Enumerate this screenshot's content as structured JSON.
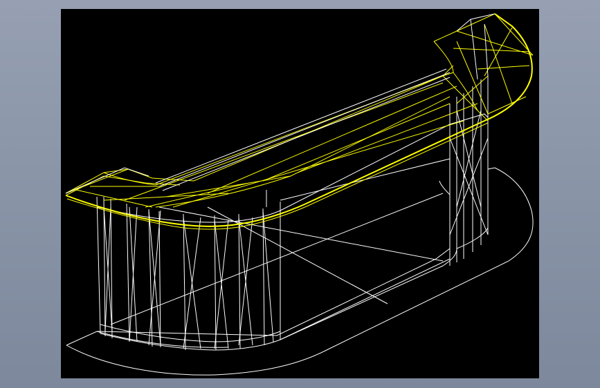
{
  "viewport": {
    "background": "#000000",
    "frame_background": "#8e99ac"
  },
  "colors": {
    "base_wire": "#ffffff",
    "countertop_wire": "#ffff00"
  },
  "model": {
    "kind": "wireframe 3D reception counter",
    "parts": [
      "floor-outline",
      "counter-body",
      "countertop"
    ]
  }
}
